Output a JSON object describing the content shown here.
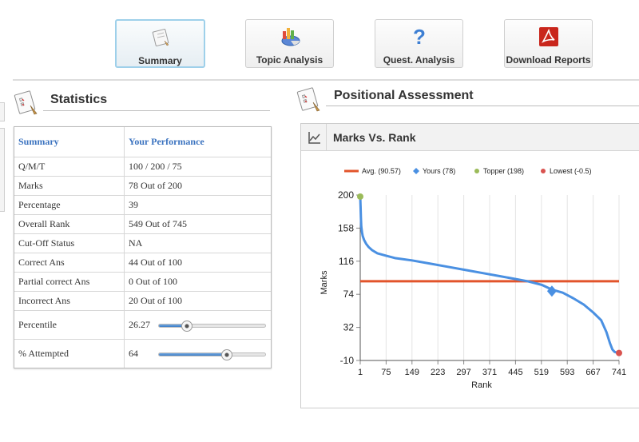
{
  "nav": {
    "tiles": [
      {
        "label": "Summary",
        "icon": "summary-notepad-icon",
        "active": true
      },
      {
        "label": "Topic Analysis",
        "icon": "topic-chart-icon",
        "active": false
      },
      {
        "label": "Quest. Analysis",
        "icon": "question-mark-icon",
        "active": false
      },
      {
        "label": "Download Reports",
        "icon": "pdf-icon",
        "active": false
      }
    ]
  },
  "statistics": {
    "title": "Statistics",
    "icon": "notepad-icon",
    "header": {
      "col1": "Summary",
      "col2": "Your Performance"
    },
    "rows": [
      {
        "label": "Q/M/T",
        "value": "100 / 200 / 75"
      },
      {
        "label": "Marks",
        "value": "78 Out of 200"
      },
      {
        "label": "Percentage",
        "value": "39"
      },
      {
        "label": "Overall Rank",
        "value": "549 Out of 745"
      },
      {
        "label": "Cut-Off Status",
        "value": "NA"
      },
      {
        "label": "Correct Ans",
        "value": "44 Out of 100"
      },
      {
        "label": "Partial correct Ans",
        "value": "0 Out of 100"
      },
      {
        "label": "Incorrect Ans",
        "value": "20 Out of 100"
      }
    ],
    "sliders": [
      {
        "label": "Percentile",
        "value": "26.27",
        "fraction": 0.2627
      },
      {
        "label": "% Attempted",
        "value": "64",
        "fraction": 0.64
      }
    ]
  },
  "positional": {
    "title": "Positional Assessment",
    "icon": "notepad-icon",
    "chart_title": "Marks Vs. Rank",
    "chart_icon": "line-chart-icon"
  },
  "chart_data": {
    "type": "line",
    "title": "Marks Vs. Rank",
    "xlabel": "Rank",
    "ylabel": "Marks",
    "xlim": [
      1,
      741
    ],
    "ylim": [
      -10,
      200
    ],
    "x_ticks": [
      "1",
      "75",
      "149",
      "223",
      "297",
      "371",
      "445",
      "519",
      "593",
      "667",
      "741"
    ],
    "y_ticks": [
      "200",
      "158",
      "116",
      "74",
      "32",
      "-10"
    ],
    "grid": "vertical",
    "legend": {
      "position": "top",
      "items": [
        {
          "label": "Avg. (90.57)",
          "marker": "line",
          "color": "#e2542b"
        },
        {
          "label": "Yours (78)",
          "marker": "diamond",
          "color": "#4a90e2"
        },
        {
          "label": "Topper (198)",
          "marker": "circle",
          "color": "#9bbb59"
        },
        {
          "label": "Lowest (-0.5)",
          "marker": "circle",
          "color": "#d9534f"
        }
      ]
    },
    "series": [
      {
        "color": "#4a90e2",
        "x": [
          1,
          2,
          3,
          4,
          6,
          8,
          12,
          18,
          25,
          35,
          50,
          75,
          100,
          149,
          200,
          250,
          300,
          350,
          400,
          450,
          480,
          520,
          549,
          580,
          610,
          640,
          667,
          690,
          705,
          715,
          722,
          728,
          735,
          741
        ],
        "y": [
          198,
          185,
          170,
          160,
          153,
          148,
          143,
          138,
          134,
          130,
          126,
          123,
          120,
          117,
          113,
          109,
          105,
          101,
          97,
          93,
          90.5,
          86,
          80,
          76,
          69,
          61,
          51,
          41,
          26,
          12,
          4,
          1,
          0,
          -0.5
        ]
      }
    ],
    "average": 90.57,
    "yours": {
      "x": 549,
      "y": 78
    },
    "topper": {
      "x": 1,
      "y": 198
    },
    "lowest": {
      "x": 741,
      "y": -0.5
    }
  }
}
